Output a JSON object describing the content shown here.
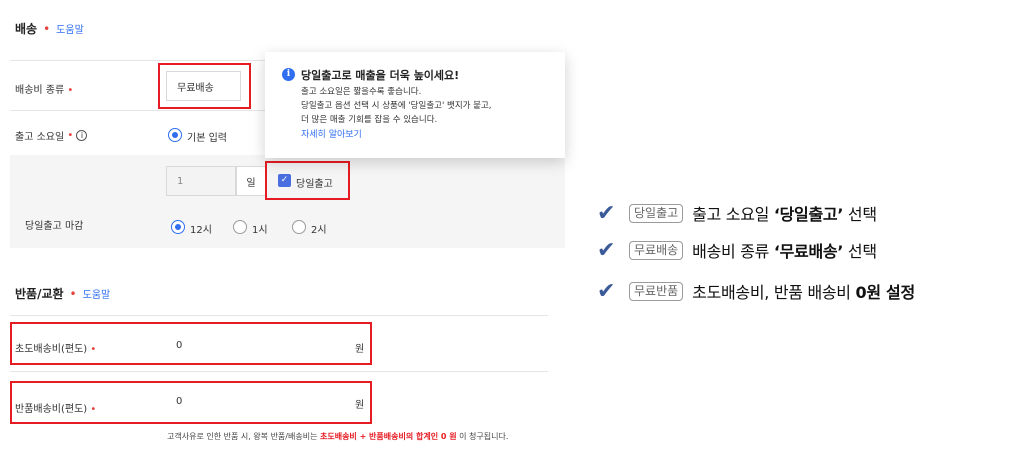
{
  "delivery": {
    "title": "배송",
    "help": "도움말",
    "fee_type_label": "배송비 종류",
    "fee_type_value": "무료배송",
    "lead_time_label": "출고 소요일",
    "lead_time_info_icon": "info-circle-icon",
    "lead_time_option": "기본 입력",
    "days_value": "1",
    "days_unit": "일",
    "same_day_checkbox": "당일출고",
    "cutoff_label": "당일출고 마감",
    "cutoff_options": [
      "12시",
      "1시",
      "2시"
    ],
    "cutoff_selected": "12시"
  },
  "tooltip": {
    "icon": "info-icon",
    "title": "당일출고로 매출을 더욱 높이세요!",
    "lines": [
      "출고 소요일은 짧을수록 좋습니다.",
      "당일출고 옵션 선택 시 상품에 '당일출고' 뱃지가 붙고,",
      "더 많은 매출 기회를 잡을 수 있습니다."
    ],
    "link": "자세히 알아보기"
  },
  "return": {
    "title": "반품/교환",
    "help": "도움말",
    "initial_fee_label": "초도배송비(편도)",
    "initial_fee_value": "0",
    "return_fee_label": "반품배송비(편도)",
    "return_fee_value": "0",
    "currency": "원",
    "note_pre": "고객사유로 인한 반품 시, 왕복 반품/배송비는 ",
    "note_hl": "초도배송비 + 반품배송비의 합계인 0 원",
    "note_post": " 이 청구됩니다."
  },
  "summary": [
    {
      "icon": "checkmark-icon",
      "tag": "당일출고",
      "text_pre": "출고 소요일 ",
      "text_bold": "‘당일출고’",
      "text_post": " 선택"
    },
    {
      "icon": "checkmark-icon",
      "tag": "무료배송",
      "text_pre": "배송비 종류 ",
      "text_bold": "‘무료배송’",
      "text_post": " 선택"
    },
    {
      "icon": "checkmark-icon",
      "tag": "무료반품",
      "text_pre": "초도배송비, 반품 배송비 ",
      "text_bold": "0원 설정",
      "text_post": ""
    }
  ],
  "colors": {
    "accent_blue": "#2f6ef0",
    "highlight_red": "#e51c23",
    "required_dot": "#e8403a",
    "check_color": "#3b5b98"
  }
}
